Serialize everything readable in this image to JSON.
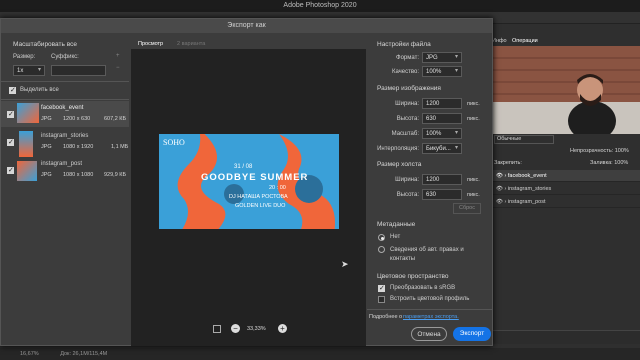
{
  "app_title": "Adobe Photoshop 2020",
  "dialog": {
    "title": "Экспорт как",
    "scale_all": "Масштабировать все",
    "size_label": "Размер:",
    "suffix_label": "Суффикс:",
    "size_value": "1x",
    "select_all": "Выделить все",
    "items": [
      {
        "name": "facebook_event",
        "format": "JPG",
        "dims": "1200 x 630",
        "size": "607,2 КБ"
      },
      {
        "name": "instagram_stories",
        "format": "JPG",
        "dims": "1080 x 1920",
        "size": "1,1 МБ"
      },
      {
        "name": "instagram_post",
        "format": "JPG",
        "dims": "1080 x 1080",
        "size": "929,9 КБ"
      }
    ],
    "tab_preview": "Просмотр",
    "tab_variants": "2 варианта",
    "poster": {
      "brand": "SOHO",
      "date": "31 / 08",
      "headline": "GOODBYE SUMMER",
      "time": "20 : 00",
      "line1": "DJ НАТАША РОСТОВА",
      "line2": "GOLDEN LIVE DUO"
    },
    "zoom": "33,33%",
    "file_settings": "Настройки файла",
    "format_label": "Формат:",
    "format_value": "JPG",
    "quality_label": "Качество:",
    "quality_value": "100%",
    "image_size": "Размер изображения",
    "width_label": "Ширина:",
    "width_value": "1200",
    "height_label": "Высота:",
    "height_value": "630",
    "unit": "пикс.",
    "scale_label": "Масштаб:",
    "scale_value": "100%",
    "interp_label": "Интерполяция:",
    "interp_value": "Бикуби...",
    "canvas_size": "Размер холста",
    "canvas_width": "1200",
    "canvas_height": "630",
    "reset": "Сброс",
    "metadata": "Метаданные",
    "meta_none": "Нет",
    "meta_copyright": "Сведения об авт. правах и контакты",
    "colorspace": "Цветовое пространство",
    "convert_srgb": "Преобразовать в sRGB",
    "embed_profile": "Встроить цветовой профиль",
    "more_info": "Подробнее о",
    "more_link": "параметрах экспорта.",
    "cancel": "Отмена",
    "export": "Экспорт"
  },
  "panel": {
    "tab_info": "Инфо",
    "tab_ops": "Операции",
    "blend": "Обычные",
    "opacity_label": "Непрозрачность:",
    "opacity_value": "100%",
    "lock_label": "Закрепить:",
    "fill_label": "Заливка:",
    "fill_value": "100%",
    "kind": "Вид",
    "layers": [
      "facebook_event",
      "instagram_stories",
      "instagram_post"
    ]
  },
  "status": {
    "zoom": "16,67%",
    "doc": "Док: 26,1М/115,4М"
  },
  "colors": {
    "accent": "#1473e6",
    "poster_blue": "#3aa0d8",
    "poster_orange": "#f0663a"
  }
}
